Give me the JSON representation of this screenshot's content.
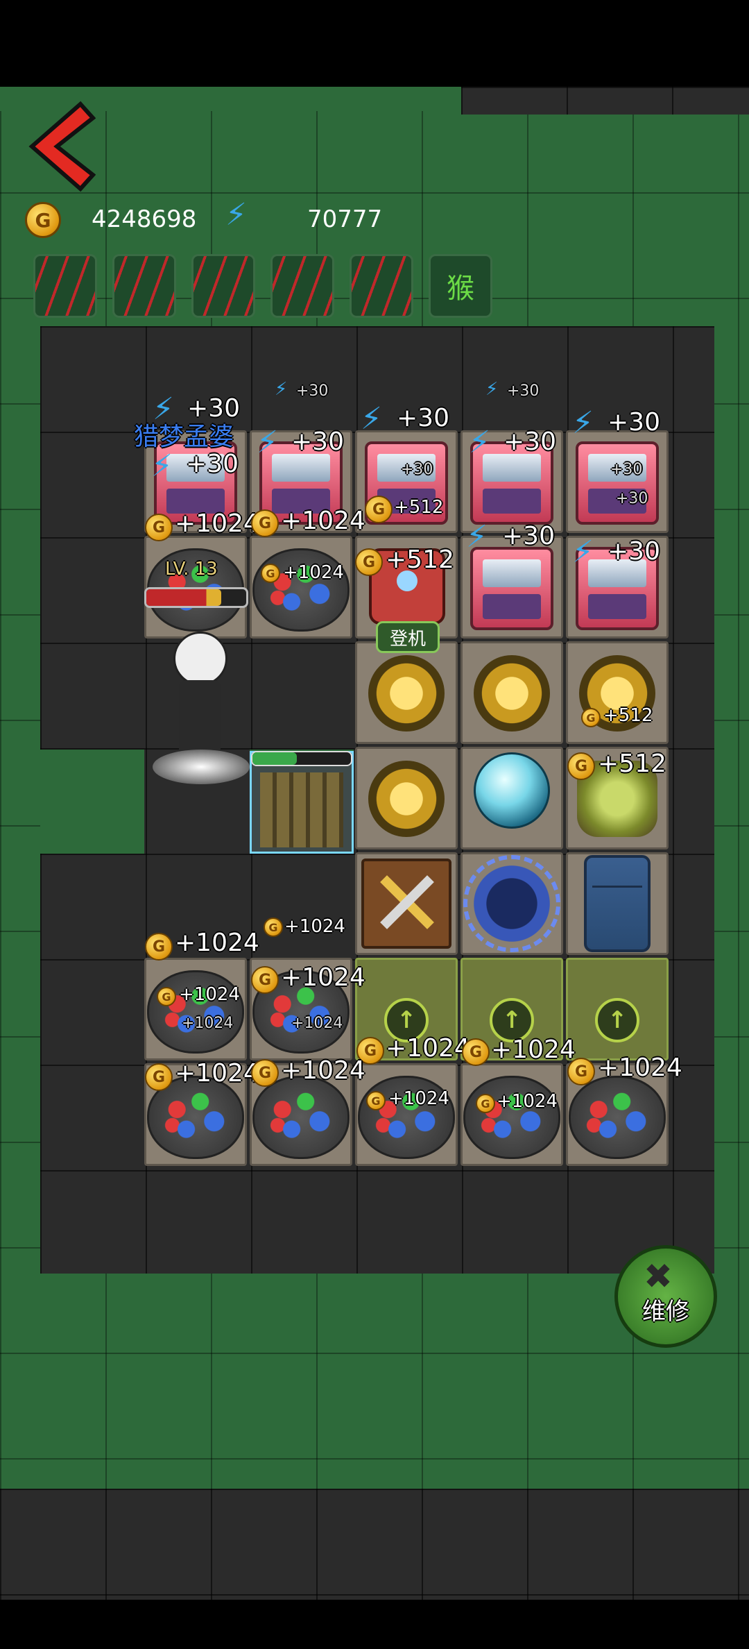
{
  "hud": {
    "gold": "4248698",
    "energy": "70777",
    "coin_glyph": "G"
  },
  "player": {
    "name": "猎梦孟婆",
    "level": "LV. 13",
    "hp_fraction": 0.75
  },
  "buttons": {
    "boarding_label": "登机",
    "repair_label": "维修",
    "upgrade_glyph": "↑"
  },
  "status_slot_glyph": "猴",
  "popups": {
    "energy_small": "+30",
    "energy_big": "+30",
    "coin_1024": "+1024",
    "coin_512": "+512"
  },
  "door_hp_fraction": 0.45,
  "colors": {
    "grass": "#2d6a3a",
    "floor": "#8a8072",
    "energy": "#39a7e8",
    "gold": "#e09a12",
    "hp_red": "#c0282a",
    "accent_green": "#b6d24a"
  },
  "icons": {
    "back": "chevron-left-icon",
    "gold": "gold-coin-icon",
    "energy": "lightning-icon",
    "repair": "wrench-gear-icon"
  }
}
